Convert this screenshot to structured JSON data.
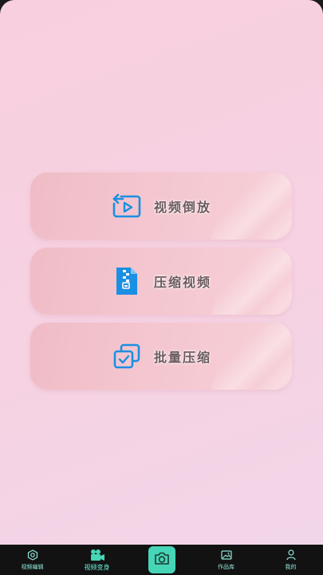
{
  "main": {
    "cards": [
      {
        "label": "视频倒放",
        "icon": "video-reverse-icon"
      },
      {
        "label": "压缩视频",
        "icon": "zip-file-icon"
      },
      {
        "label": "批量压缩",
        "icon": "batch-check-icon"
      }
    ]
  },
  "tabbar": {
    "items": [
      {
        "label": "视频编辑",
        "icon": "hexagon-settings-icon"
      },
      {
        "label": "视频变身",
        "icon": "video-camera-icon"
      },
      {
        "label": "",
        "icon": "camera-icon"
      },
      {
        "label": "作品库",
        "icon": "image-icon"
      },
      {
        "label": "我的",
        "icon": "user-icon"
      }
    ]
  },
  "colors": {
    "accent": "#46d6b7",
    "icon_blue": "#1b8fe3",
    "background_pink": "#f8cfdf"
  }
}
